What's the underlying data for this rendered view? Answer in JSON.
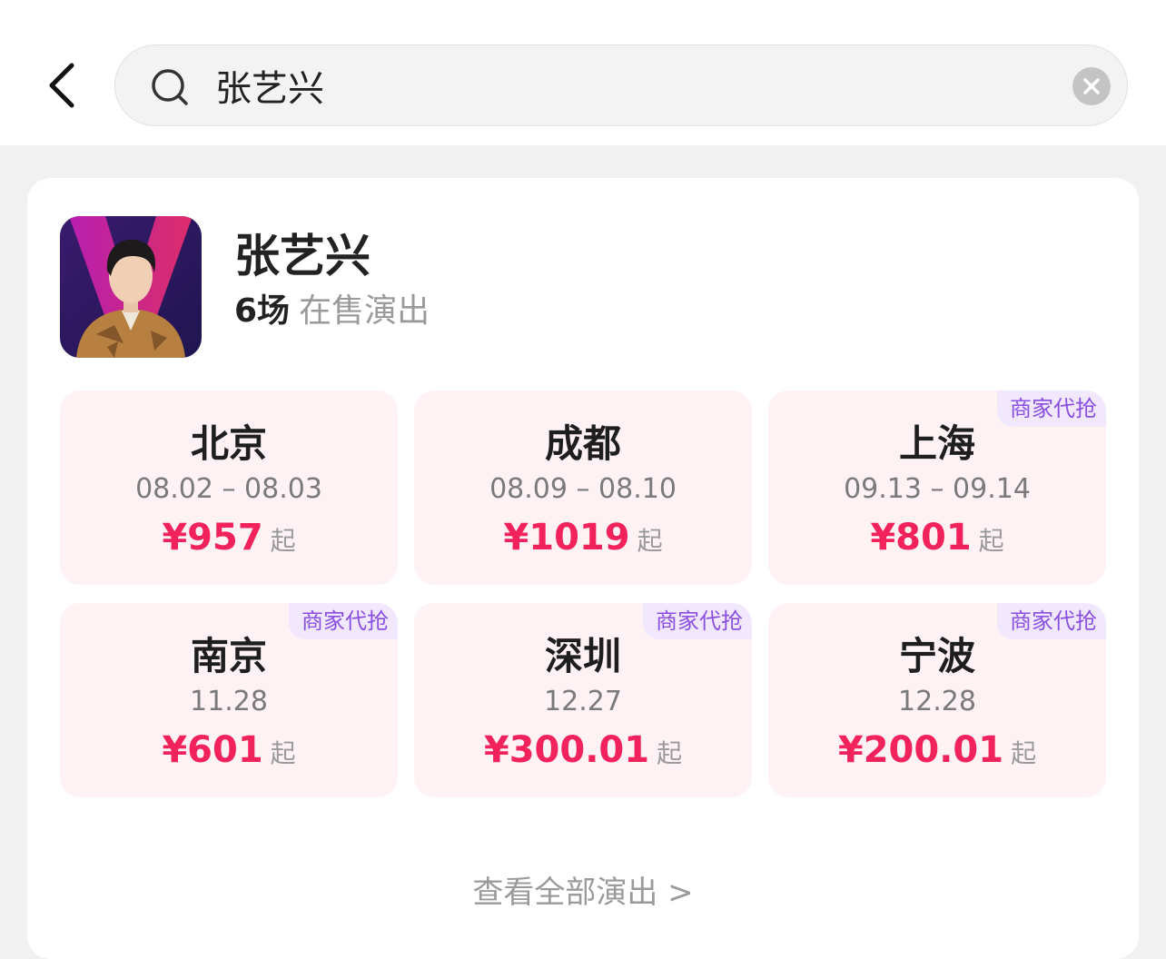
{
  "search": {
    "value": "张艺兴",
    "icon": "search-icon"
  },
  "artist": {
    "name": "张艺兴",
    "show_count": "6场",
    "show_label": "在售演出"
  },
  "shows": [
    {
      "city": "北京",
      "date": "08.02 – 08.03",
      "price": "¥957",
      "from": "起",
      "badge": ""
    },
    {
      "city": "成都",
      "date": "08.09 – 08.10",
      "price": "¥1019",
      "from": "起",
      "badge": ""
    },
    {
      "city": "上海",
      "date": "09.13 – 09.14",
      "price": "¥801",
      "from": "起",
      "badge": "商家代抢"
    },
    {
      "city": "南京",
      "date": "11.28",
      "price": "¥601",
      "from": "起",
      "badge": "商家代抢"
    },
    {
      "city": "深圳",
      "date": "12.27",
      "price": "¥300.01",
      "from": "起",
      "badge": "商家代抢"
    },
    {
      "city": "宁波",
      "date": "12.28",
      "price": "¥200.01",
      "from": "起",
      "badge": "商家代抢"
    }
  ],
  "footer": {
    "view_all": "查看全部演出 >"
  },
  "colors": {
    "price": "#f2225d",
    "badge_text": "#8a4fe0",
    "badge_bg": "#f1e8fd",
    "tile_bg": "#fff2f5"
  }
}
